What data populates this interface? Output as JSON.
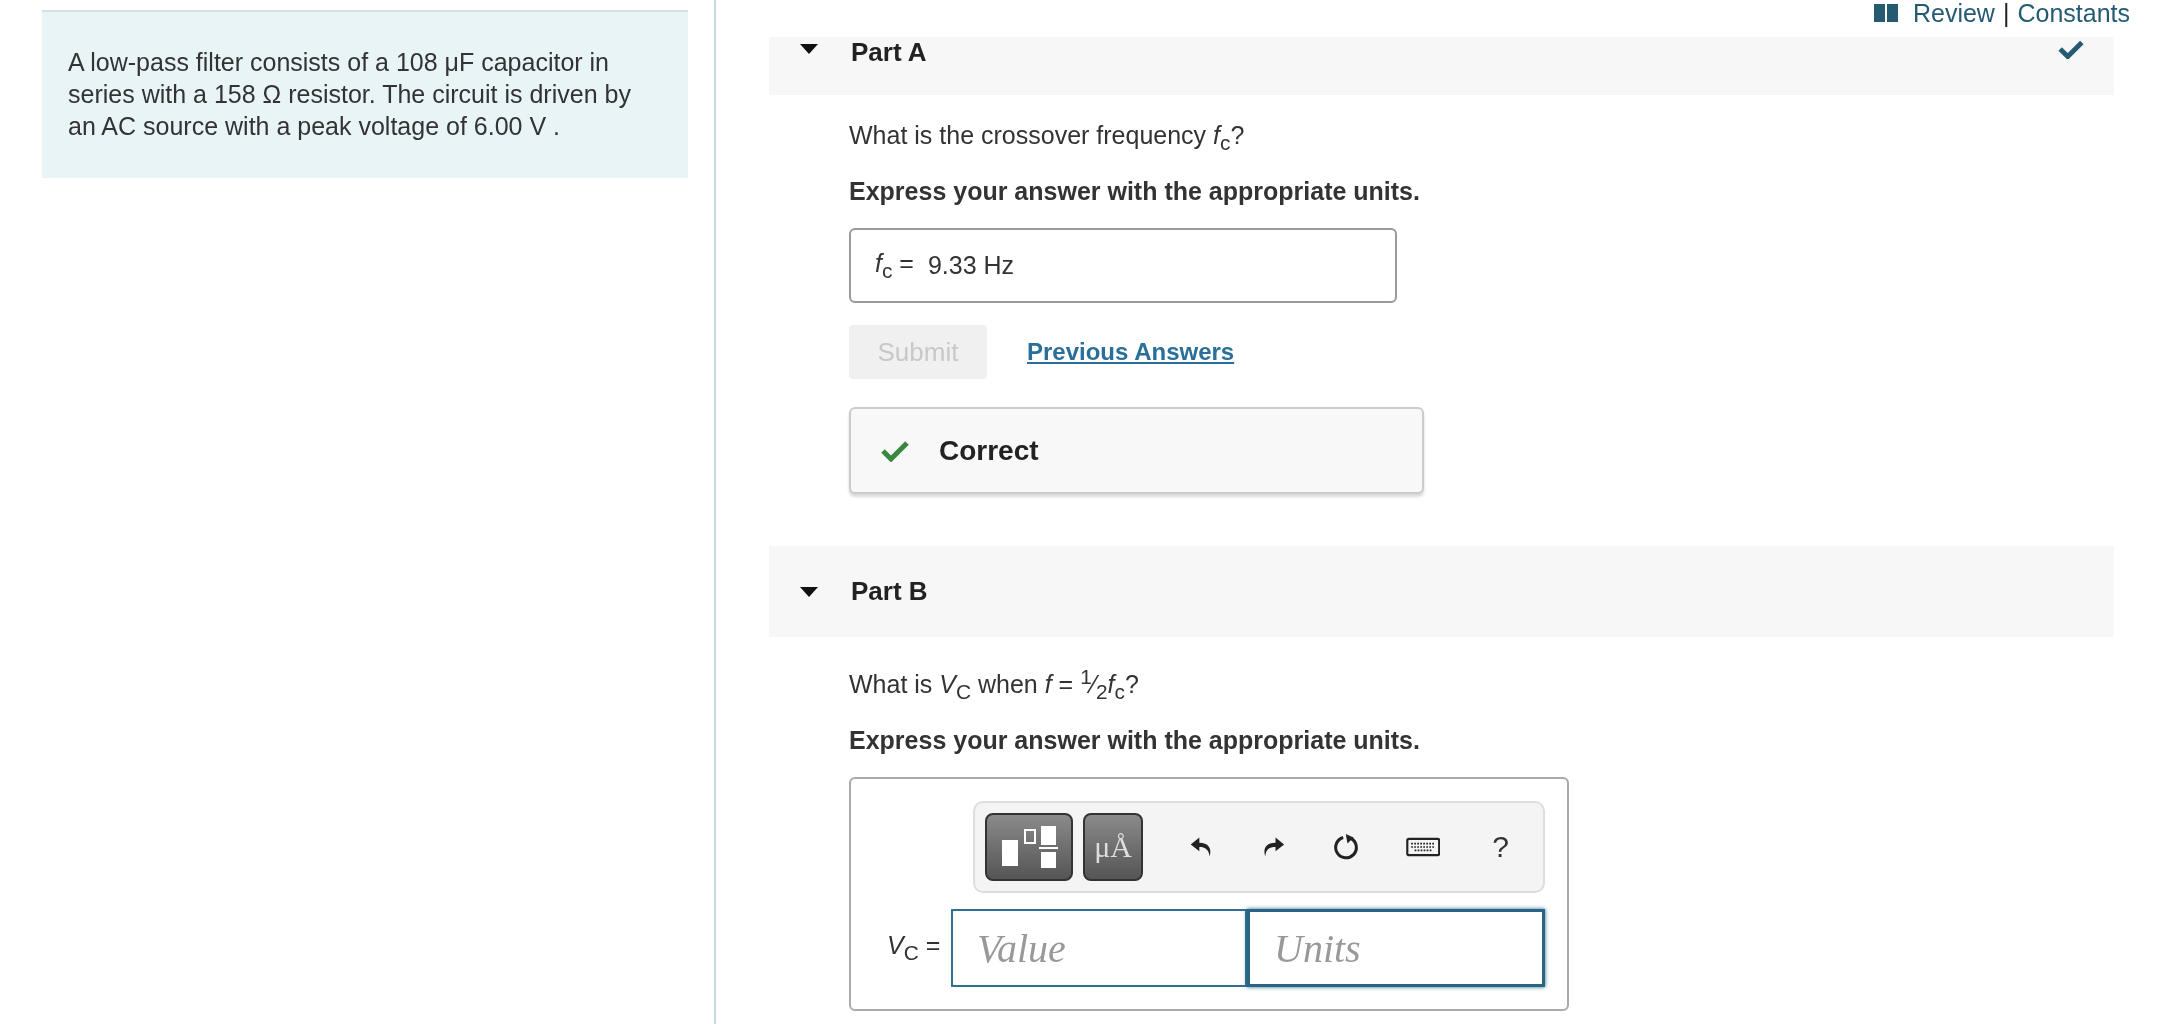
{
  "header_links": {
    "review": "Review",
    "separator": "|",
    "constants": "Constants"
  },
  "problem": {
    "text": "A low-pass filter consists of a 108 μF capacitor in series with a 158 Ω resistor. The circuit is driven by an AC source with a peak voltage of 6.00 V ."
  },
  "parts": [
    {
      "title": "Part A",
      "expanded": true,
      "completed": true,
      "kind": "answered",
      "question": "What is the crossover frequency *f*$_{c}$?",
      "instruction": "Express your answer with the appropriate units.",
      "answer": {
        "label": "*f*$_{c}$ =",
        "value": "9.33 Hz"
      },
      "submit": {
        "label": "Submit",
        "disabled": true
      },
      "previous_answers": "Previous Answers",
      "feedback": {
        "kind": "correct",
        "text": "Correct"
      }
    },
    {
      "title": "Part B",
      "expanded": true,
      "completed": false,
      "kind": "input",
      "question": "What is *V*$_{C}$ when *f* = $^{1}$⁄$_{2}$*f*$_{c}$?",
      "instruction": "Express your answer with the appropriate units.",
      "toolbar": [
        {
          "kind": "templates"
        },
        {
          "kind": "units",
          "label": "μÅ"
        },
        {
          "kind": "undo"
        },
        {
          "kind": "redo"
        },
        {
          "kind": "reset"
        },
        {
          "kind": "keyboard"
        },
        {
          "kind": "help",
          "label": "?"
        }
      ],
      "answer": {
        "label": "*V*$_{C}$ =",
        "value_placeholder": "Value",
        "units_placeholder": "Units",
        "value_focused": false,
        "units_focused": true
      }
    }
  ]
}
